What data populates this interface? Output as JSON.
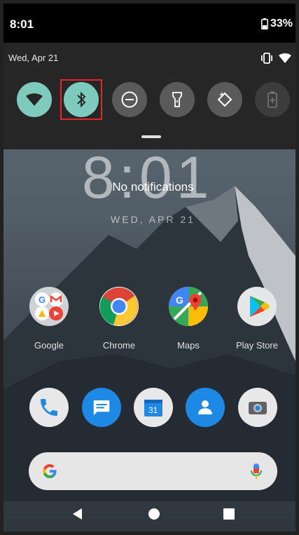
{
  "status_bar": {
    "time": "8:01",
    "battery": "33%"
  },
  "quick_settings": {
    "date": "Wed, Apr 21",
    "tiles": [
      {
        "name": "wifi",
        "icon": "wifi-icon",
        "state": "on"
      },
      {
        "name": "bluetooth",
        "icon": "bluetooth-icon",
        "state": "on"
      },
      {
        "name": "do-not-disturb",
        "icon": "dnd-icon",
        "state": "off"
      },
      {
        "name": "flashlight",
        "icon": "flashlight-icon",
        "state": "off"
      },
      {
        "name": "auto-rotate",
        "icon": "rotate-icon",
        "state": "off"
      },
      {
        "name": "battery-saver",
        "icon": "battery-saver-icon",
        "state": "disabled"
      }
    ]
  },
  "lockscreen": {
    "clock": "8:01",
    "notifications": "No notifications",
    "date": "WED, APR 21"
  },
  "apps": [
    {
      "label": "Google",
      "icon": "google-folder-icon"
    },
    {
      "label": "Chrome",
      "icon": "chrome-icon"
    },
    {
      "label": "Maps",
      "icon": "maps-icon"
    },
    {
      "label": "Play Store",
      "icon": "play-store-icon"
    }
  ],
  "dock": [
    {
      "name": "phone",
      "icon": "phone-icon"
    },
    {
      "name": "messages",
      "icon": "messages-icon"
    },
    {
      "name": "calendar",
      "icon": "calendar-icon",
      "text": "31"
    },
    {
      "name": "contacts",
      "icon": "contacts-icon"
    },
    {
      "name": "camera",
      "icon": "camera-icon"
    }
  ],
  "search_bar": {
    "logo": "G"
  },
  "colors": {
    "tile_on": "#7ecbbd",
    "highlight": "#e5262d"
  }
}
